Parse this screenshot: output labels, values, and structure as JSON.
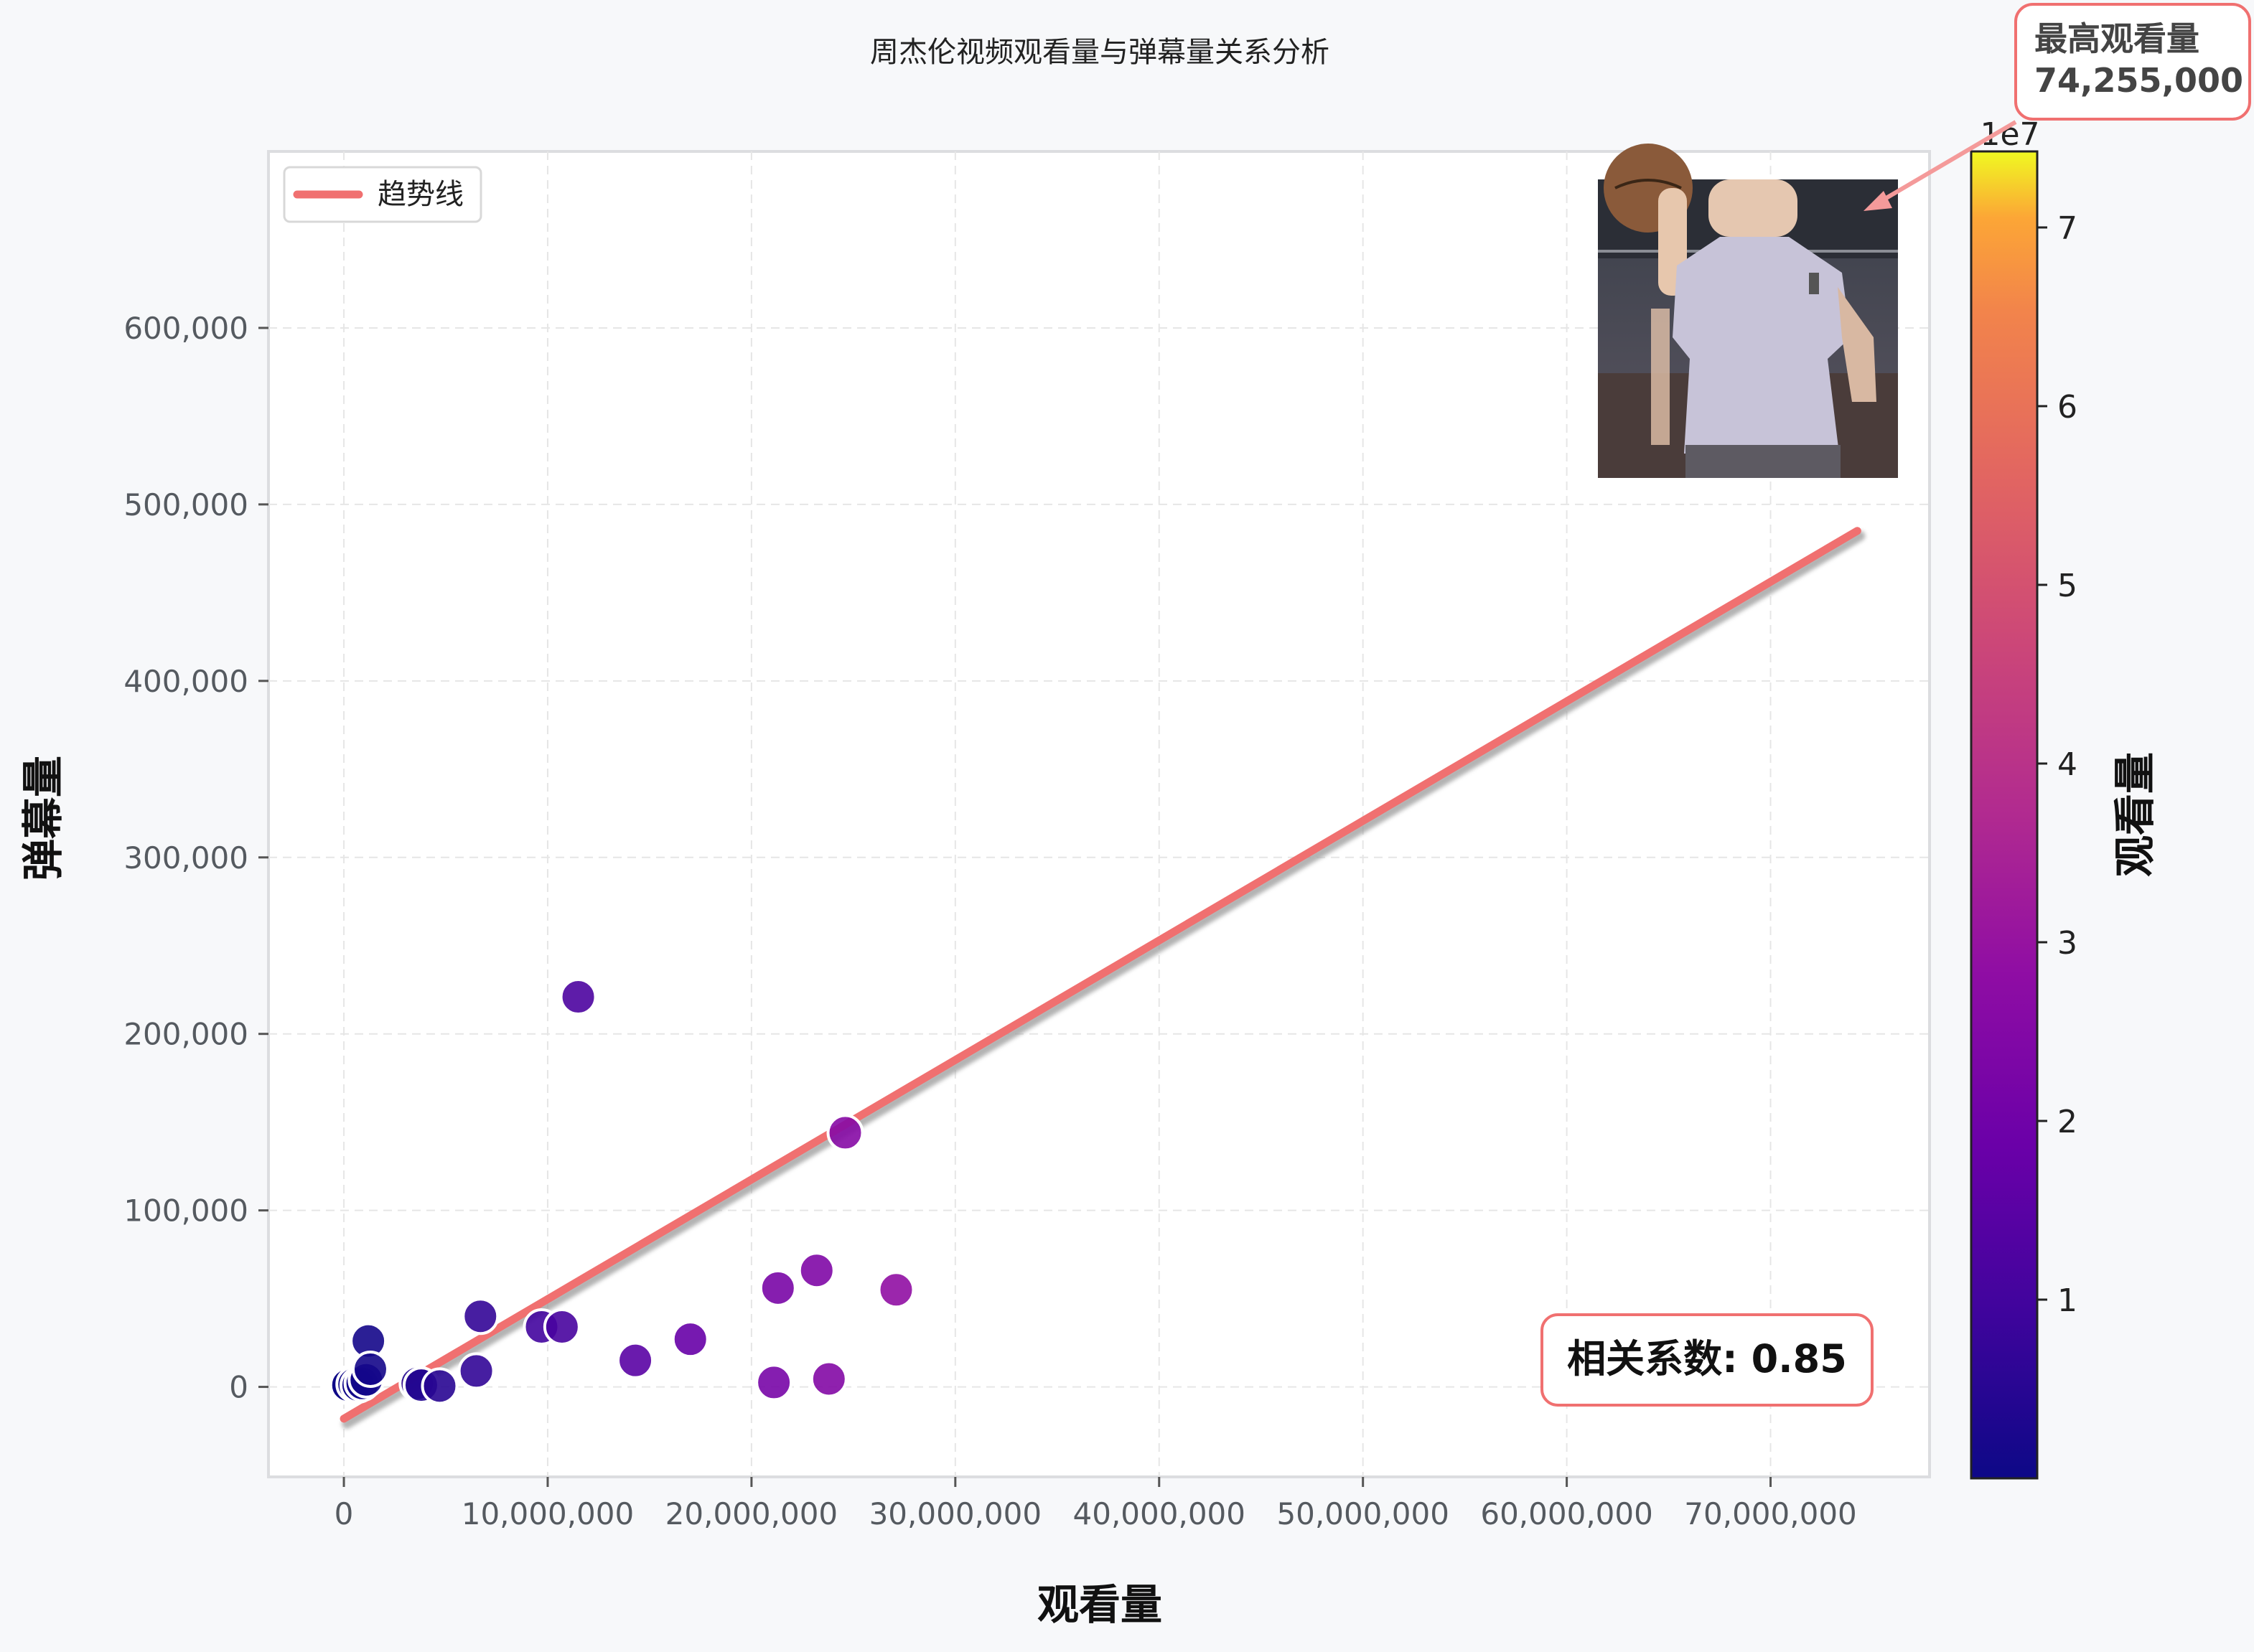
{
  "chart_data": {
    "type": "scatter",
    "title": "周杰伦视频观看量与弹幕量关系分析",
    "xlabel": "观看量",
    "ylabel": "弹幕量",
    "xlim": [
      -3700000,
      77800000
    ],
    "ylim": [
      -51000,
      700000
    ],
    "x_ticks": [
      0,
      10000000,
      20000000,
      30000000,
      40000000,
      50000000,
      60000000,
      70000000
    ],
    "x_tick_labels": [
      "0",
      "10,000,000",
      "20,000,000",
      "30,000,000",
      "40,000,000",
      "50,000,000",
      "60,000,000",
      "70,000,000"
    ],
    "y_ticks": [
      0,
      100000,
      200000,
      300000,
      400000,
      500000,
      600000
    ],
    "y_tick_labels": [
      "0",
      "100,000",
      "200,000",
      "300,000",
      "400,000",
      "500,000",
      "600,000"
    ],
    "grid": true,
    "legend_position": "top-left",
    "legend": [
      "趋势线"
    ],
    "trendline": {
      "name": "趋势线",
      "x": [
        0,
        74255000
      ],
      "y": [
        -18000,
        485000
      ],
      "color": "#f07070"
    },
    "points": [
      {
        "x": 30000,
        "y": 500
      },
      {
        "x": 100000,
        "y": 800
      },
      {
        "x": 200000,
        "y": 1000
      },
      {
        "x": 500000,
        "y": 1500
      },
      {
        "x": 700000,
        "y": 1000
      },
      {
        "x": 900000,
        "y": 2000
      },
      {
        "x": 1100000,
        "y": 4000
      },
      {
        "x": 1200000,
        "y": 26000
      },
      {
        "x": 1300000,
        "y": 10000
      },
      {
        "x": 3600000,
        "y": 2000
      },
      {
        "x": 3800000,
        "y": 1000
      },
      {
        "x": 4700000,
        "y": 500
      },
      {
        "x": 6500000,
        "y": 9000
      },
      {
        "x": 6700000,
        "y": 40000
      },
      {
        "x": 9700000,
        "y": 34000
      },
      {
        "x": 10700000,
        "y": 34000
      },
      {
        "x": 11500000,
        "y": 221000
      },
      {
        "x": 14300000,
        "y": 15000
      },
      {
        "x": 17000000,
        "y": 27000
      },
      {
        "x": 21100000,
        "y": 2500
      },
      {
        "x": 21300000,
        "y": 56000
      },
      {
        "x": 23200000,
        "y": 66000
      },
      {
        "x": 23800000,
        "y": 4500
      },
      {
        "x": 24600000,
        "y": 144000
      },
      {
        "x": 27100000,
        "y": 55000
      }
    ],
    "colorbar": {
      "label": "观看量",
      "colormap": "plasma",
      "offset_text": "1e7",
      "range": [
        0,
        74255000
      ],
      "ticks": [
        1,
        2,
        3,
        4,
        5,
        6,
        7
      ],
      "tick_labels": [
        "1",
        "2",
        "3",
        "4",
        "5",
        "6",
        "7"
      ]
    },
    "annotations": {
      "max_label": "最高观看量",
      "max_value": "74,255,000",
      "correlation": "相关系数: 0.85"
    },
    "inset_image": "portrait-photo"
  }
}
